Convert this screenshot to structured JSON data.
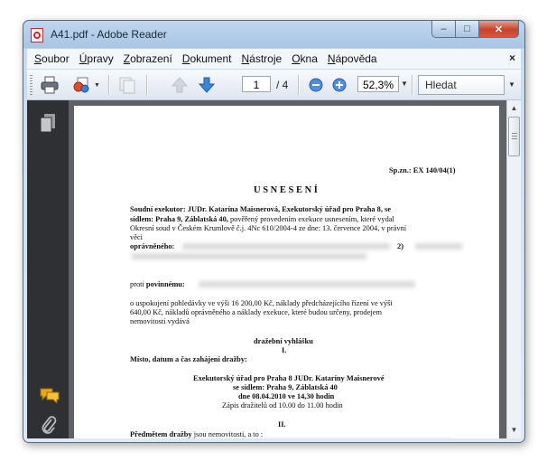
{
  "window": {
    "title": "A41.pdf - Adobe Reader",
    "controls": {
      "minimize": "–",
      "maximize": "□",
      "close": "✕"
    }
  },
  "menu": {
    "items": [
      "Soubor",
      "Úpravy",
      "Zobrazení",
      "Dokument",
      "Nástroje",
      "Okna",
      "Nápověda"
    ],
    "close_glyph": "×"
  },
  "toolbar": {
    "page_current": "1",
    "page_total": "/ 4",
    "zoom": "52,3%",
    "search_placeholder": "Hledat",
    "icons": [
      "print-icon",
      "share-icon",
      "review-icon",
      "page-up-icon",
      "page-down-icon",
      "zoom-out-icon",
      "zoom-in-icon"
    ]
  },
  "sidebar": {
    "icons": [
      "pages-icon",
      "comments-icon",
      "attachments-icon"
    ]
  },
  "document": {
    "spzn": "Sp.zn.: EX 140/04(1)",
    "heading": "U S N E S E N Í",
    "p1_bold": "Soudní exekutor: JUDr. Katarína Maisnerová, Exekutorský úřad pro Praha 8, se",
    "p1_line2_bold": "sídlem: Praha 9, Záblatská 40,",
    "p1_line2_rest": "pověřený provedením exekuce usnesením, které vydal",
    "p1_line3": "Okresní soud v Českém Krumlově č.j. 4Nc 610/2004-4 ze dne: 13. července 2004, v právní",
    "p1_line4": "věci",
    "opravneneho": "oprávněného:",
    "opravneneho_suffix": "2)",
    "proti": "proti",
    "povinnemu": "povinnému:",
    "p2_line1": "o uspokojení pohledávky   ve výši 16 200,00 Kč, náklady předcházejícího řízení ve výši",
    "p2_line2": "640,00 Kč, nákladů oprávněného a náklady exekuce, které budou určeny,   prodejem",
    "p2_line3": "nemovitostí vydává",
    "vyhlaska": "dražební vyhlášku",
    "roman1": "I.",
    "misto": "Místo, datum a čas zahájení dražby:",
    "urad1": "Exekutorský úřad pro Praha 8 JUDr. Kataríny Maisnerové",
    "urad2": "se sídlem: Praha 9, Záblatská 40",
    "urad3": "dne 08.04.2010 ve 14,30 hodin",
    "urad4": "Zápis dražitelů od 10.00 do 11.00 hodin",
    "roman2": "II.",
    "predmet_bold": "Předmětem dražby",
    "predmet_rest": "jsou nemovitosti, a to :"
  }
}
